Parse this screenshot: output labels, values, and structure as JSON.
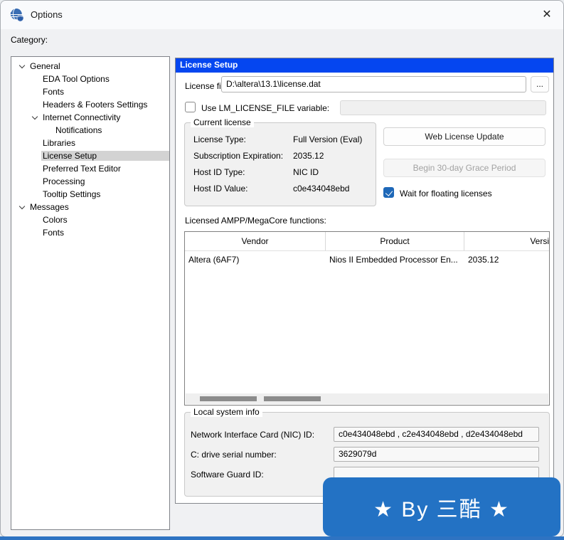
{
  "window": {
    "title": "Options",
    "close_glyph": "✕"
  },
  "category_label": "Category:",
  "tree": {
    "items": [
      {
        "label": "General",
        "level": 0,
        "expanded": true
      },
      {
        "label": "EDA Tool Options",
        "level": 1
      },
      {
        "label": "Fonts",
        "level": 1
      },
      {
        "label": "Headers & Footers Settings",
        "level": 1
      },
      {
        "label": "Internet Connectivity",
        "level": 1,
        "expanded": true
      },
      {
        "label": "Notifications",
        "level": 2
      },
      {
        "label": "Libraries",
        "level": 1
      },
      {
        "label": "License Setup",
        "level": 1,
        "selected": true
      },
      {
        "label": "Preferred Text Editor",
        "level": 1
      },
      {
        "label": "Processing",
        "level": 1
      },
      {
        "label": "Tooltip Settings",
        "level": 1
      },
      {
        "label": "Messages",
        "level": 0,
        "expanded": true
      },
      {
        "label": "Colors",
        "level": 1
      },
      {
        "label": "Fonts",
        "level": 1
      }
    ]
  },
  "panel": {
    "header": "License Setup",
    "license_file": {
      "label": "License file:",
      "value": "D:\\altera\\13.1\\license.dat",
      "browse": "..."
    },
    "lm_license": {
      "label": "Use LM_LICENSE_FILE variable:",
      "checked": false,
      "value": ""
    },
    "current_license": {
      "title": "Current license",
      "rows": [
        {
          "label": "License Type:",
          "value": "Full Version (Eval)"
        },
        {
          "label": "Subscription Expiration:",
          "value": "2035.12"
        },
        {
          "label": "Host ID Type:",
          "value": "NIC ID"
        },
        {
          "label": "Host ID Value:",
          "value": "c0e434048ebd"
        }
      ]
    },
    "buttons": {
      "web_license_update": "Web License Update",
      "grace_period": "Begin 30-day Grace Period"
    },
    "wait_floating": {
      "label": "Wait for floating licenses",
      "checked": true
    },
    "functions_table": {
      "label": "Licensed AMPP/MegaCore functions:",
      "columns": [
        "Vendor",
        "Product",
        "Versi"
      ],
      "rows": [
        [
          "Altera (6AF7)",
          "Nios II Embedded Processor En...",
          "2035.12"
        ]
      ]
    },
    "local_system": {
      "title": "Local system info",
      "rows": [
        {
          "label": "Network Interface Card (NIC) ID:",
          "value": "c0e434048ebd , c2e434048ebd , d2e434048ebd"
        },
        {
          "label": "C: drive serial number:",
          "value": "3629079d"
        },
        {
          "label": "Software Guard ID:",
          "value": ""
        }
      ]
    }
  },
  "watermark": {
    "text": "★ By 三酷 ★"
  },
  "colors": {
    "panel_header_blue": "#0546f0",
    "checkbox_accent": "#1e68b8",
    "badge_blue": "#2372c4",
    "selection_gray": "#d3d3d3",
    "bottom_strip_blue": "#2e73c2"
  }
}
